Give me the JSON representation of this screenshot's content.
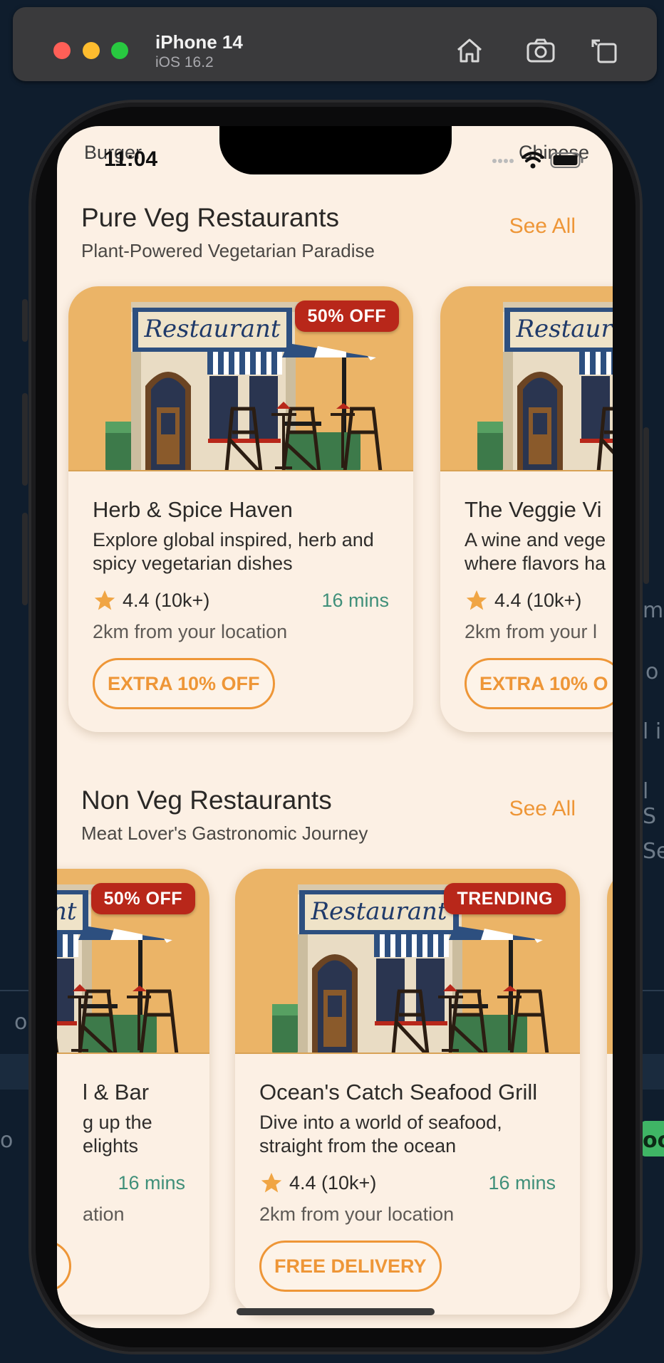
{
  "simulator": {
    "device": "iPhone 14",
    "os": "iOS 16.2",
    "icons": [
      "home-icon",
      "screenshot-icon",
      "rotate-icon"
    ]
  },
  "background_fragments": [
    "mm",
    "o",
    "l i",
    "l S",
    "Se",
    "o",
    "o",
    "oo"
  ],
  "status_bar": {
    "time": "11:04",
    "icons": [
      "signal-icon",
      "wifi-icon",
      "battery-icon"
    ]
  },
  "category_peek": {
    "left": "Burger",
    "right": "Chinese"
  },
  "sections": [
    {
      "title": "Pure Veg Restaurants",
      "subtitle": "Plant-Powered Vegetarian Paradise",
      "see_all": "See All",
      "cards": [
        {
          "image_sign": "Restaurant",
          "badge": "50% OFF",
          "name": "Herb & Spice Haven",
          "description": "Explore global inspired, herb and spicy vegetarian dishes",
          "rating": "4.4 (10k+)",
          "eta": "16 mins",
          "distance": "2km from your location",
          "offer": "EXTRA 10% OFF"
        },
        {
          "image_sign": "Restaurant",
          "badge": "",
          "name": "The Veggie Vi",
          "description": "A wine and vege where flavors ha",
          "rating": "4.4 (10k+)",
          "eta": "",
          "distance": "2km from your l",
          "offer": "EXTRA 10% O"
        }
      ]
    },
    {
      "title": "Non Veg Restaurants",
      "subtitle": "Meat Lover's Gastronomic Journey",
      "see_all": "See All",
      "cards": [
        {
          "image_sign": "Restaurant",
          "badge": "50% OFF",
          "name": "l & Bar",
          "description": "g up the elights",
          "rating": "",
          "eta": "16 mins",
          "distance": "ation",
          "offer": ""
        },
        {
          "image_sign": "Restaurant",
          "badge": "TRENDING",
          "name": "Ocean's Catch Seafood Grill",
          "description": "Dive into a world of seafood, straight from the ocean",
          "rating": "4.4 (10k+)",
          "eta": "16 mins",
          "distance": "2km from your location",
          "offer": "FREE DELIVERY"
        }
      ]
    }
  ],
  "colors": {
    "accent": "#ee9637",
    "badge": "#b8271a",
    "eta": "#3f8f79",
    "card_bg": "#fcf0e4",
    "image_bg": "#ebb467"
  }
}
